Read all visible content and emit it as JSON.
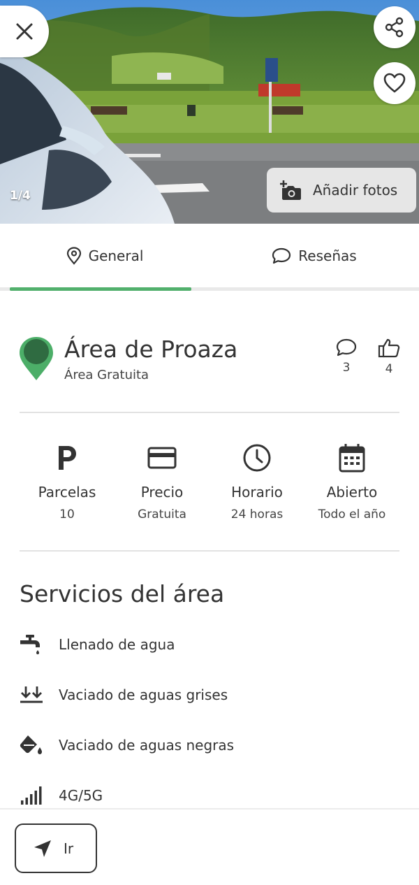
{
  "photo": {
    "counter": "1/4",
    "add_photos_label": "Añadir fotos"
  },
  "tabs": [
    {
      "label": "General",
      "icon": "location-pin-icon",
      "active": true
    },
    {
      "label": "Reseñas",
      "icon": "comment-icon",
      "active": false
    }
  ],
  "place": {
    "name": "Área de Proaza",
    "type": "Área Gratuita",
    "comments_count": "3",
    "likes_count": "4"
  },
  "info": [
    {
      "icon": "parking-icon",
      "title": "Parcelas",
      "value": "10"
    },
    {
      "icon": "credit-card-icon",
      "title": "Precio",
      "value": "Gratuita"
    },
    {
      "icon": "clock-icon",
      "title": "Horario",
      "value": "24 horas"
    },
    {
      "icon": "calendar-icon",
      "title": "Abierto",
      "value": "Todo el año"
    }
  ],
  "services": {
    "title": "Servicios del área",
    "items": [
      {
        "icon": "water-tap-icon",
        "label": "Llenado de agua"
      },
      {
        "icon": "double-arrow-down-icon",
        "label": "Vaciado de aguas grises"
      },
      {
        "icon": "paint-bucket-icon",
        "label": "Vaciado de aguas negras"
      },
      {
        "icon": "signal-bars-icon",
        "label": "4G/5G"
      }
    ]
  },
  "actions": {
    "go_label": "Ir"
  },
  "colors": {
    "accent": "#52b06c",
    "pin": "#4cae68",
    "pin_dark": "#2f6b41",
    "text": "#333333"
  }
}
